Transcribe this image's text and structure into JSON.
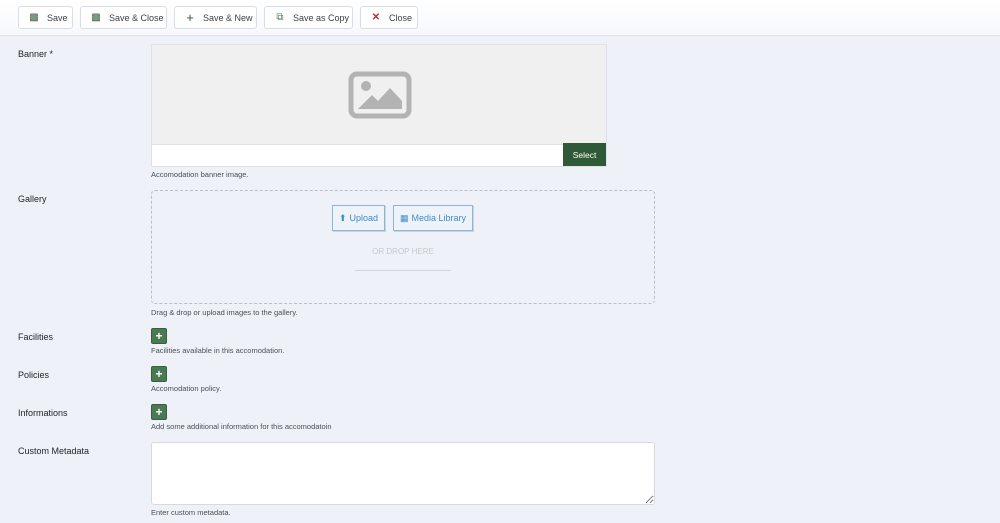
{
  "toolbar": {
    "save": "Save",
    "save_close": "Save & Close",
    "save_new": "Save & New",
    "save_copy": "Save as Copy",
    "close": "Close"
  },
  "banner": {
    "label": "Banner *",
    "select": "Select",
    "help": "Accomodation banner image."
  },
  "gallery": {
    "label": "Gallery",
    "upload": "Upload",
    "media_library": "Media Library",
    "drop": "OR DROP HERE",
    "help": "Drag & drop or upload images to the gallery."
  },
  "facilities": {
    "label": "Facilities",
    "help": "Facilities available in this accomodation."
  },
  "policies": {
    "label": "Policies",
    "help": "Accomodation policy."
  },
  "informations": {
    "label": "Informations",
    "help": "Add some additional information for this accomodatoin"
  },
  "metadata": {
    "label": "Custom Metadata",
    "value": "",
    "help": "Enter custom metadata."
  },
  "colors": {
    "primary": "#2f5a37",
    "link": "#3d8dc4"
  }
}
